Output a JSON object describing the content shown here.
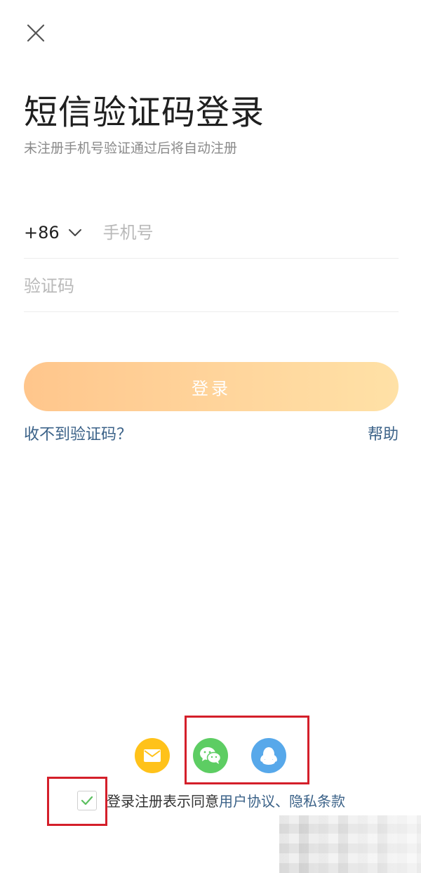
{
  "header": {
    "close_icon": "close-icon",
    "title": "短信验证码登录",
    "subtitle": "未注册手机号验证通过后将自动注册"
  },
  "form": {
    "country_code": "+86",
    "phone_placeholder": "手机号",
    "code_placeholder": "验证码",
    "login_label": "登录",
    "no_code_link": "收不到验证码？",
    "help_link": "帮助"
  },
  "social": [
    {
      "icon": "mail-icon",
      "color": "#ffc21a"
    },
    {
      "icon": "wechat-icon",
      "color": "#5dcd63"
    },
    {
      "icon": "qq-icon",
      "color": "#57a8ea"
    }
  ],
  "agreement": {
    "checked": true,
    "prefix": "登录注册表示同意",
    "user_agreement": "用户协议",
    "separator": "、",
    "privacy_policy": "隐私条款"
  },
  "colors": {
    "accent_link": "#3b6288",
    "button_gradient_start": "#ffc68c",
    "button_gradient_end": "#ffe1a6",
    "annotation_red": "#d41f2a"
  }
}
